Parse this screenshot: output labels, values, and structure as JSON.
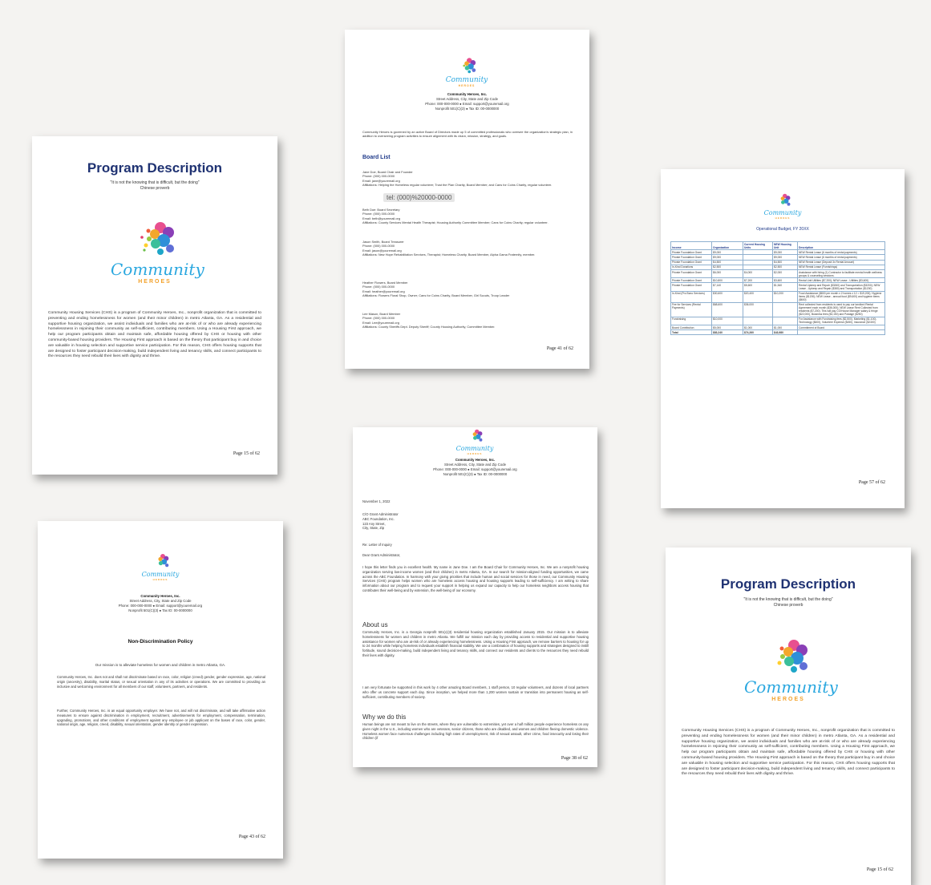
{
  "org": {
    "name": "Community Heroes, Inc.",
    "address": "Street Address, City, State and Zip Code",
    "contact": "Phone: 000-000-0000 ● Email: support@youremail.org",
    "tax": "Nonprofit 501(C)(3) ● Tax ID: 00-0000000",
    "logo_word": "Community",
    "logo_sub": "HEROES"
  },
  "program": {
    "title": "Program Description",
    "quote": "\"It is not the knowing that is difficult, but the doing\"",
    "quote_src": "Chinese proverb",
    "body": "Community Housing Services (CHS) is a program of Community Heroes, Inc., nonprofit organization that is committed to preventing and ending homelessness for women (and their minor children) in metro Atlanta, GA. As a residential and supportive housing organization, we assist individuals and families who are at-risk of or who are already experiencing homelessness in rejoining their community as self-sufficient, contributing members. Using a Housing First approach, we help our program participants obtain and maintain safe, affordable housing offered by CHS or housing with other community-based housing providers. The Housing First approach is based on the theory that participant buy in and choice are valuable in housing selection and supportive service participation. For this reason, CHS offers housing supports that are designed to foster participant decision-making, build independent living and tenancy skills, and connect participants to the resources they need rebuild their lives with dignity and thrive.",
    "page_label": "Page 15 of 62"
  },
  "board": {
    "intro": "Community Heroes is governed by an active Board of Directors made up 5 of committed professionals who oversee the organization's strategic plan, in addition to overseeing program activities to ensure alignment with its vision, mission, strategy, and goals.",
    "heading": "Board List",
    "tooltip": "tel: (000)%20000-0000",
    "entries": [
      {
        "name": "Jane Doe, Board Chair and Founder",
        "phone": "Phone: (000) 000-0000",
        "email": "Email: jane@youremail.org",
        "aff": "Affiliations: Helping the Homeless regular volunteer; Trust the Plan Charity, Board Member; and Cans for Coins Charity, regular volunteer."
      },
      {
        "name": "Beth Doe: Board Secretary",
        "phone": "Phone: (000) 000-0000",
        "email": "Email: beth@youremail.org",
        "aff": "Affiliations: County Services Mental Health Therapist; Housing Authority Committee Member; Cans for Coins Charity, regular volunteer."
      },
      {
        "name": "Jason Smith, Board Treasurer",
        "phone": "Phone: (000) 000-0000",
        "email": "Email: jason@youremail.org",
        "aff": "Affiliations: New Hope Rehabilitation Services, Therapist; Homeless Charity, Board Member, Alpha Gama Fraternity, member."
      },
      {
        "name": "Heather Flowers, Board Member",
        "phone": "Phone: (000) 000-0000",
        "email": "Email: heather@youremail.org",
        "aff": "Affiliations: Flowers Floral Shop, Owner; Cans for Coins Charity, Board Member, Girl Scouts, Troop Leader"
      },
      {
        "name": "Lee Mason, Board Member",
        "phone": "Phone: (000) 000-0000",
        "email": "Email: Lee@youremail.org",
        "aff": "Affiliations: County Sheriffs Dept. Deputy Sheriff; County Housing Authority, Committee Member."
      }
    ],
    "page_label": "Page 41 of 62"
  },
  "budget": {
    "title": "Operational Budget, FY 20XX",
    "headers": [
      "Income",
      "Organization",
      "Current Housing Units",
      "NEW Housing Unit",
      "Description"
    ],
    "rows": [
      [
        "Private Foundation Grant",
        "$9,000",
        "",
        "$9,000",
        "NEW Rental Lease (6 months of rental payments)"
      ],
      [
        "Private Foundation Grant",
        "$9,000",
        "",
        "$9,000",
        "NEW Rental Lease (6 months of rental payments)"
      ],
      [
        "Private Foundation Grant",
        "$4,500",
        "",
        "$4,500",
        "NEW Rental Lease (Deposit 3x Rental Amount)"
      ],
      [
        "In-Kind Donations",
        "$2,500",
        "",
        "$2,500",
        "NEW Rental Lease (Furnishings)"
      ],
      [
        "Private Foundation Grant",
        "$6,000",
        "$4,000",
        "$2,000",
        "Assistance with hiring (1) Contractor to facilitate mental health wellness groups & counseling sessions."
      ],
      [
        "Private Foundation Grant",
        "$10,800",
        "$7,200",
        "$3,600",
        "Rental Unit Utilities ($7,200); NEW Lease - Utilities ($3,600)"
      ],
      [
        "Private Foundation Grant",
        "$7,140",
        "$5,600",
        "$1,540",
        "Rental Upkeep and Repair ($3260) and Transportation ($3200); NEW Lease - Upkeep and Repair ($380) and Transportation ($1200)"
      ],
      [
        "In-Kind (Pro Bono Services)",
        "$30,600",
        "$20,400",
        "$10,200",
        "Food Assistance ($800 per month x 2 homes x 12 = $19,200); Hygiene Items ($1200); NEW Lease - annual food ($9,600) and hygiene items ($600)"
      ],
      [
        "Fee for Services (Rental Payments)",
        "$68,600",
        "$36,000",
        "",
        "Rent collected from residents is used to pay our landlord Rental Agreement each month ($36,000); NEW Lease Rent Collected from residents ($7,200). This will pay CO/House Manager salary & fringe ($22,000), Business fees ($3,150) and Postage ($250)"
      ],
      [
        "Fundraising",
        "$10,000",
        "",
        "",
        "For Assistance with Fundraising fees ($2,500), Marketing ($1,100), Technology ($400), Volunteer Expense ($450), Insurance ($2400)"
      ],
      [
        "Board Contribution",
        "$5,000",
        "$1,000",
        "$1,000",
        "Commitment of Board"
      ],
      [
        "Total",
        "$83,240",
        "$74,260",
        "$43,980",
        ""
      ]
    ],
    "page_label": "Page 57 of 62"
  },
  "policy": {
    "title": "Non-Discrimination Policy",
    "mission": "Our mission is to alleviate homeless for women and children in metro Atlanta, GA.",
    "p1": "Community Heroes, Inc. does not and shall not discriminate based on race, color, religion (creed) gender, gender expression, age, national origin (ancestry), disability, marital status, or sexual orientation in any of its activities or operations. We are committed to providing an inclusive and welcoming environment for all members of our staff, volunteers, partners, and residents.",
    "p2": "Further, Community Heroes, Inc. is an equal opportunity employer. We have not, and will not discriminate, and will take affirmative action measures to ensure against discrimination in employment, recruitment, advertisements for employment, compensation, termination, upgrading, promotions, and other conditions of employment against any employee or job applicant on the bases of race, color, gender, national origin, age, religion, creed, disability, sexual orientation, gender identity or gender expression.",
    "page_label": "Page 43 of 62"
  },
  "letter": {
    "date": "November 1, 2022",
    "recipient": [
      "C/O Grant Administrator",
      "ABC Foundation, Inc.",
      "123 Any Street,",
      "City, State, Zip"
    ],
    "re": "Re: Letter of Inquiry",
    "salutation": "Dear Grant Administrator,",
    "p1": "I hope this letter finds you in excellent health. My name is Jane Doe. I am the Board Chair for Community Heroes, Inc. We are a nonprofit housing organization serving low-income women (and their children) in metro Atlanta, GA. In our search for mission-aligned funding opportunities, we came across the ABC Foundation. In harmony with your giving priorities that include human and social services for those in need, our Community Housing Services (CHS) program helps women who are homeless access housing and housing supports leading to self-sufficiency. I am writing to share information about our program and to request your support in helping us expand our capacity to help our homeless neighbors access housing that contributes their well-being and by extension, the well-being of our economy.",
    "about_h": "About us",
    "about": "Community Heroes, Inc. is a Georgia nonprofit 501(c)(3) residential housing organization established January 2015. Our mission is to alleviate homelessness for women and children in metro Atlanta. We fulfill our mission each day by providing access to residential and supportive housing assistance for women who are at-risk of or already experiencing homelessness. Using a Housing First approach, we remove barriers to housing for up to 24 months while helping homeless individuals establish financial stability. We use a combination of housing supports and strategies designed to instill fortitude, sound decision-making, build independent living and tenancy skills, and connect our residents and clients to the resources they need rebuild their lives with dignity.",
    "p3": "I am very fortunate be supported in this work by 4 other amazing Board members, 1 staff person, 10 regular volunteers, and dozens of local partners who offer us concrete support each day. Since inception, we helped more than 1,200 women sustain or transition into permanent housing as self-sufficient, contributing members of society.",
    "why_h": "Why we do this",
    "why": "Human beings are not meant to live on the streets, where they are vulnerable to extremities, yet over a half million people experience homeless on any given night in the U.S., including women who are veterans, senior citizens, those who are disabled, and women and children fleeing domestic violence. Homeless women face numerous challenges including high rates of unemployment, risk of sexual assault, other crime, food insecurity and losing their children (if",
    "page_label": "Page 38 of 62"
  }
}
